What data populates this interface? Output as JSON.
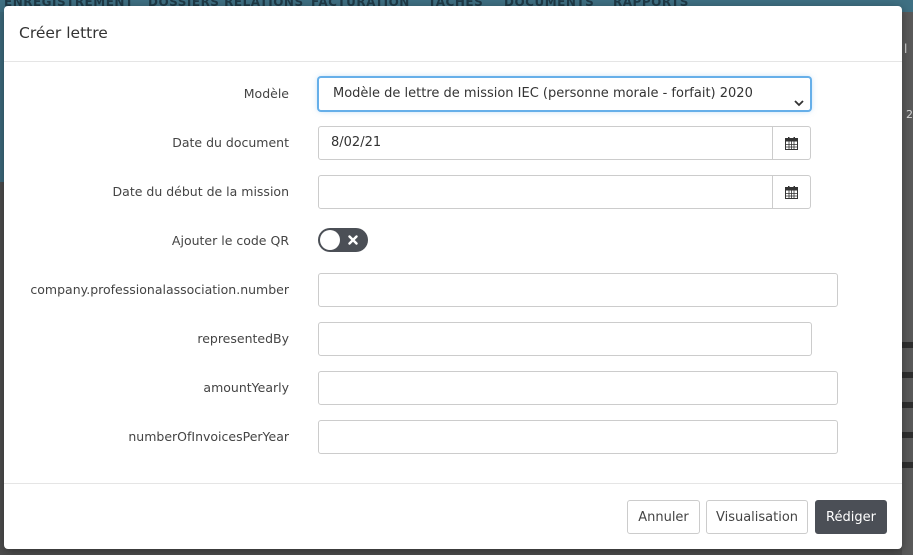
{
  "background": {
    "nav_items": [
      "ENREGISTREMENT",
      "DOSSIERS RELATIONS",
      "FACTURATION",
      "TÂCHES",
      "DOCUMENTS",
      "RAPPORTS"
    ],
    "right_edge_text_1": "l",
    "right_edge_text_2": "2"
  },
  "modal": {
    "title": "Créer lettre",
    "fields": {
      "model": {
        "label": "Modèle",
        "value": "Modèle de lettre de mission IEC (personne morale - forfait) 2020"
      },
      "document_date": {
        "label": "Date du document",
        "value": "8/02/21"
      },
      "mission_start_date": {
        "label": "Date du début de la mission",
        "value": ""
      },
      "qr_code": {
        "label": "Ajouter le code QR",
        "checked": false
      },
      "professional_association_number": {
        "label": "company.professionalassociation.number",
        "value": ""
      },
      "represented_by": {
        "label": "representedBy",
        "value": ""
      },
      "amount_yearly": {
        "label": "amountYearly",
        "value": ""
      },
      "invoices_per_year": {
        "label": "numberOfInvoicesPerYear",
        "value": ""
      }
    },
    "footer": {
      "cancel_label": "Annuler",
      "preview_label": "Visualisation",
      "submit_label": "Rédiger"
    }
  },
  "icons": {
    "calendar": "calendar-icon",
    "chevron": "chevron-down-icon",
    "toggle_off": "close-icon"
  },
  "colors": {
    "primary_button": "#4b4f56",
    "focus_border": "#66afe9",
    "background_band": "#3d6a7c"
  }
}
